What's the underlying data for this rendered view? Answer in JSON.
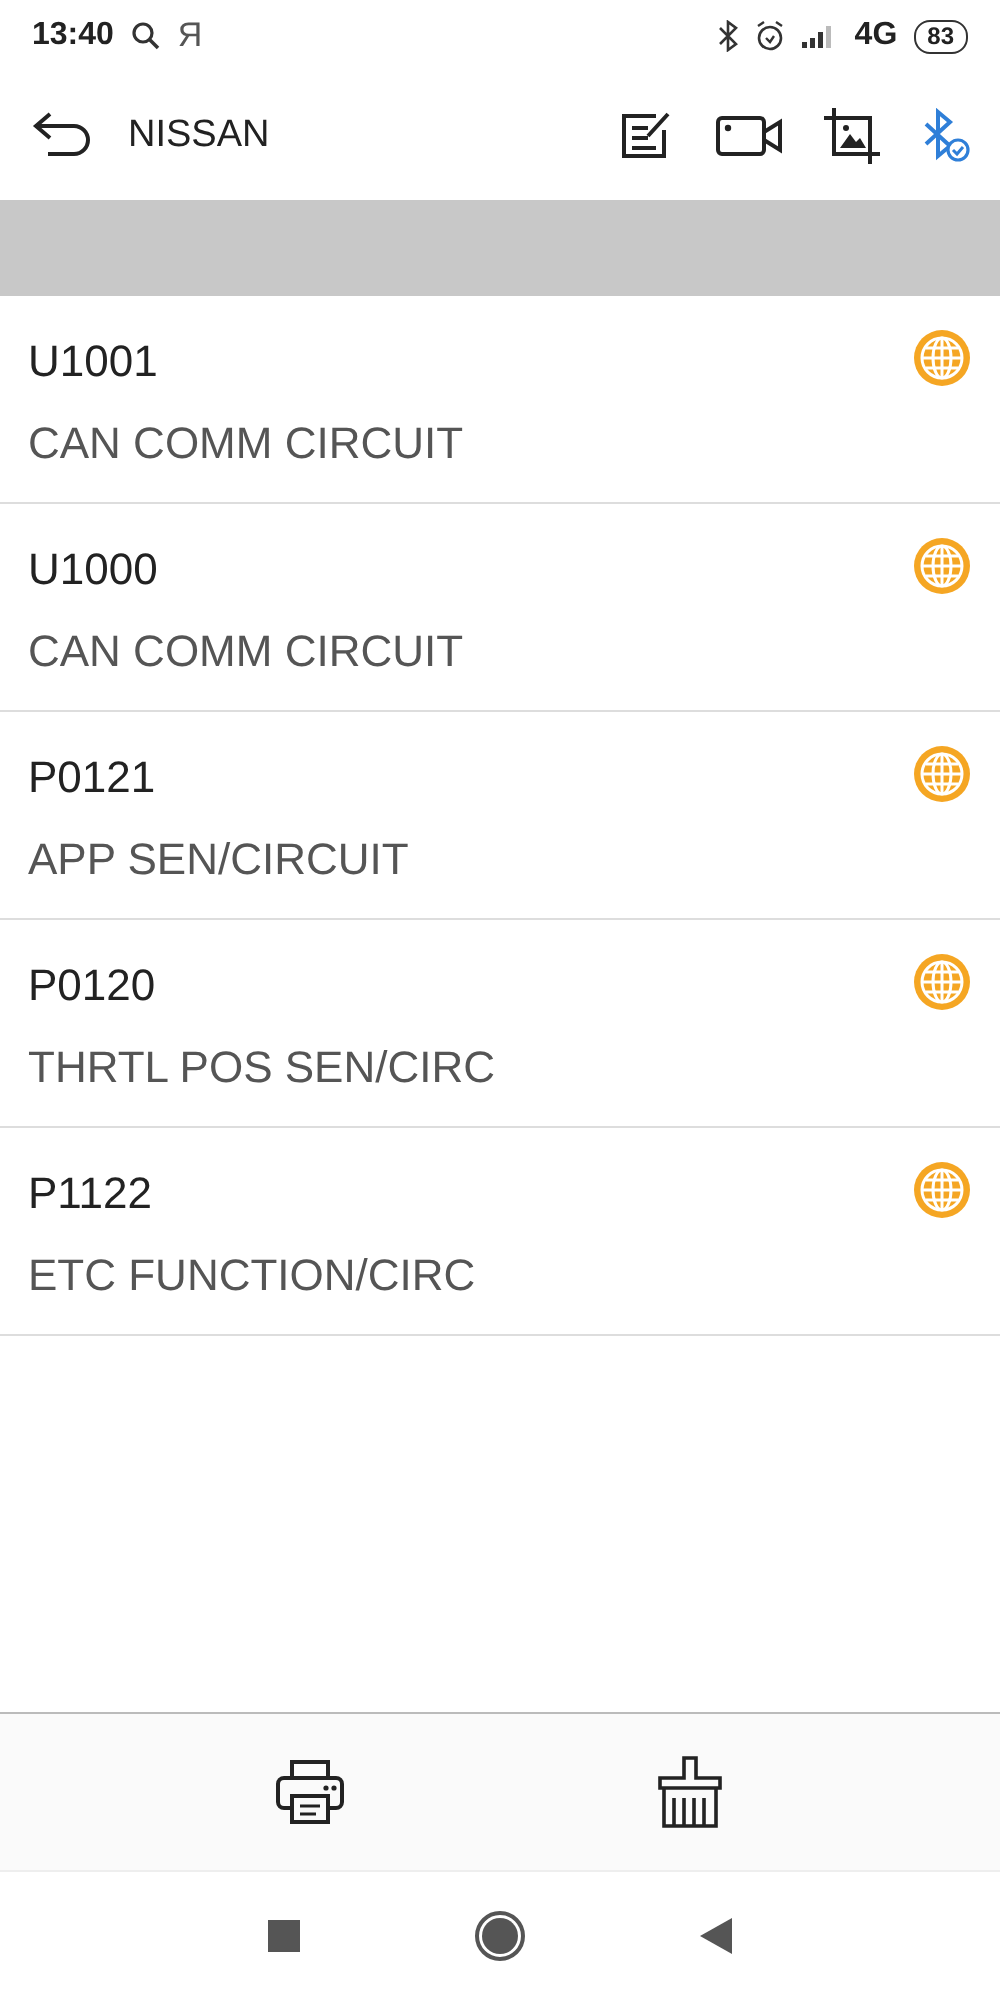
{
  "status_bar": {
    "time": "13:40",
    "app_glyph": "Я",
    "network": "4G",
    "battery": "83"
  },
  "header": {
    "title": "NISSAN"
  },
  "codes": [
    {
      "code": "U1001",
      "description": "CAN COMM CIRCUIT"
    },
    {
      "code": "U1000",
      "description": "CAN COMM CIRCUIT"
    },
    {
      "code": "P0121",
      "description": "APP SEN/CIRCUIT"
    },
    {
      "code": "P0120",
      "description": "THRTL POS SEN/CIRC"
    },
    {
      "code": "P1122",
      "description": "ETC FUNCTION/CIRC"
    }
  ]
}
